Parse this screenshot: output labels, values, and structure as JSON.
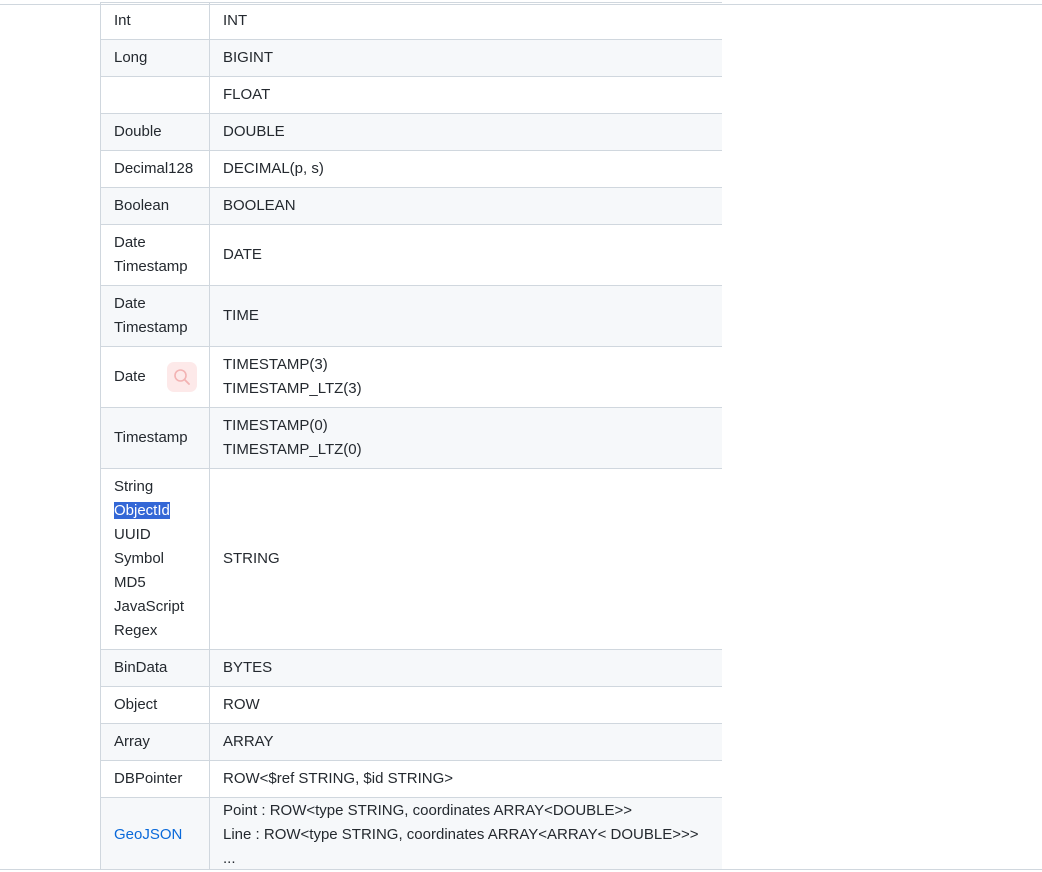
{
  "rows": [
    {
      "left": [
        "Int"
      ],
      "right": [
        "INT"
      ]
    },
    {
      "left": [
        "Long"
      ],
      "right": [
        "BIGINT"
      ]
    },
    {
      "left": [],
      "right": [
        "FLOAT"
      ]
    },
    {
      "left": [
        "Double"
      ],
      "right": [
        "DOUBLE"
      ]
    },
    {
      "left": [
        "Decimal128"
      ],
      "right": [
        "DECIMAL(p, s)"
      ]
    },
    {
      "left": [
        "Boolean"
      ],
      "right": [
        "BOOLEAN"
      ]
    },
    {
      "left": [
        "Date",
        "Timestamp"
      ],
      "right": [
        "DATE"
      ]
    },
    {
      "left": [
        "Date",
        "Timestamp"
      ],
      "right": [
        "TIME"
      ]
    },
    {
      "left": [
        "Date"
      ],
      "right": [
        "TIMESTAMP(3)",
        "TIMESTAMP_LTZ(3)"
      ]
    },
    {
      "left": [
        "Timestamp"
      ],
      "right": [
        "TIMESTAMP(0)",
        "TIMESTAMP_LTZ(0)"
      ]
    },
    {
      "left": [
        "String",
        "ObjectId",
        "UUID",
        "Symbol",
        "MD5",
        "JavaScript",
        "Regex"
      ],
      "right": [
        "STRING"
      ]
    },
    {
      "left": [
        "BinData"
      ],
      "right": [
        "BYTES"
      ]
    },
    {
      "left": [
        "Object"
      ],
      "right": [
        "ROW"
      ]
    },
    {
      "left": [
        "Array"
      ],
      "right": [
        "ARRAY"
      ]
    },
    {
      "left": [
        "DBPointer"
      ],
      "right": [
        "ROW<$ref STRING, $id STRING>"
      ]
    },
    {
      "left": [
        "GeoJSON"
      ],
      "right": [
        "Point : ROW<type STRING, coordinates ARRAY<DOUBLE>>",
        "Line : ROW<type STRING, coordinates ARRAY<ARRAY< DOUBLE>>>",
        "..."
      ]
    }
  ],
  "selection": {
    "text": "ObjectId",
    "color": "#3367d6"
  },
  "link_color": "#0969da",
  "icons": {
    "search_badge": "search-icon"
  }
}
